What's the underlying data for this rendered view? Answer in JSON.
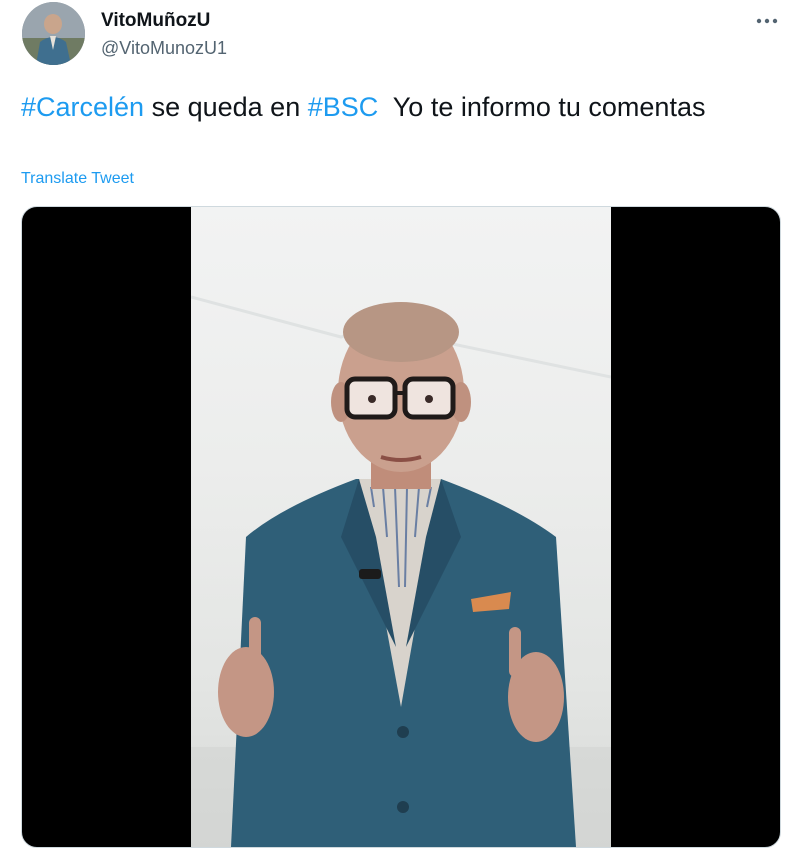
{
  "tweet": {
    "author_name": "VitoMuñozU",
    "author_handle": "@VitoMunozU1",
    "text_parts": [
      {
        "text": "#Carcelén",
        "hashtag": true
      },
      {
        "text": " se queda en ",
        "hashtag": false
      },
      {
        "text": "#BSC",
        "hashtag": true
      },
      {
        "text": "  Yo te informo tu comentas",
        "hashtag": false
      }
    ],
    "translate_label": "Translate Tweet",
    "more_icon": "ellipsis-horizontal-icon",
    "media": {
      "type": "video",
      "description_icon": "video-thumbnail"
    }
  },
  "colors": {
    "link": "#1d9bf0",
    "text": "#0f1419",
    "secondary": "#536471",
    "border": "#cfd9de"
  }
}
